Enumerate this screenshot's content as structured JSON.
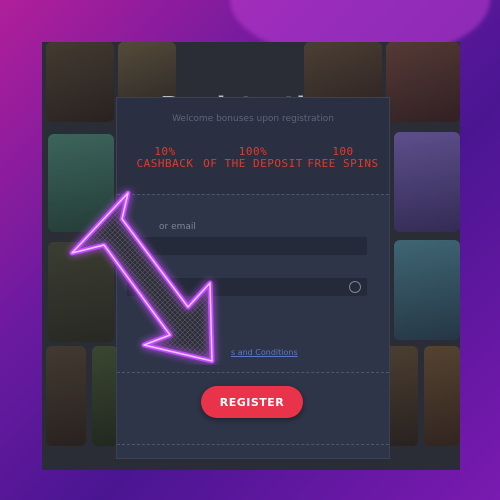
{
  "page_title": "Registration",
  "modal": {
    "welcome_text": "Welcome bonuses upon registration",
    "bonuses": [
      {
        "line1": "10%",
        "line2": "CASHBACK"
      },
      {
        "line1": "100%",
        "line2": "OF THE DEPOSIT"
      },
      {
        "line1": "100",
        "line2": "FREE SPINS"
      }
    ],
    "login_label": "or email",
    "terms_text": "s and Conditions",
    "register_button": "REGISTER"
  },
  "colors": {
    "accent_red": "#e8334a",
    "bonus_red": "#e23a2a",
    "neon_purple": "#b23cff"
  },
  "icons": [
    "eye-icon",
    "neon-arrow-icon"
  ]
}
